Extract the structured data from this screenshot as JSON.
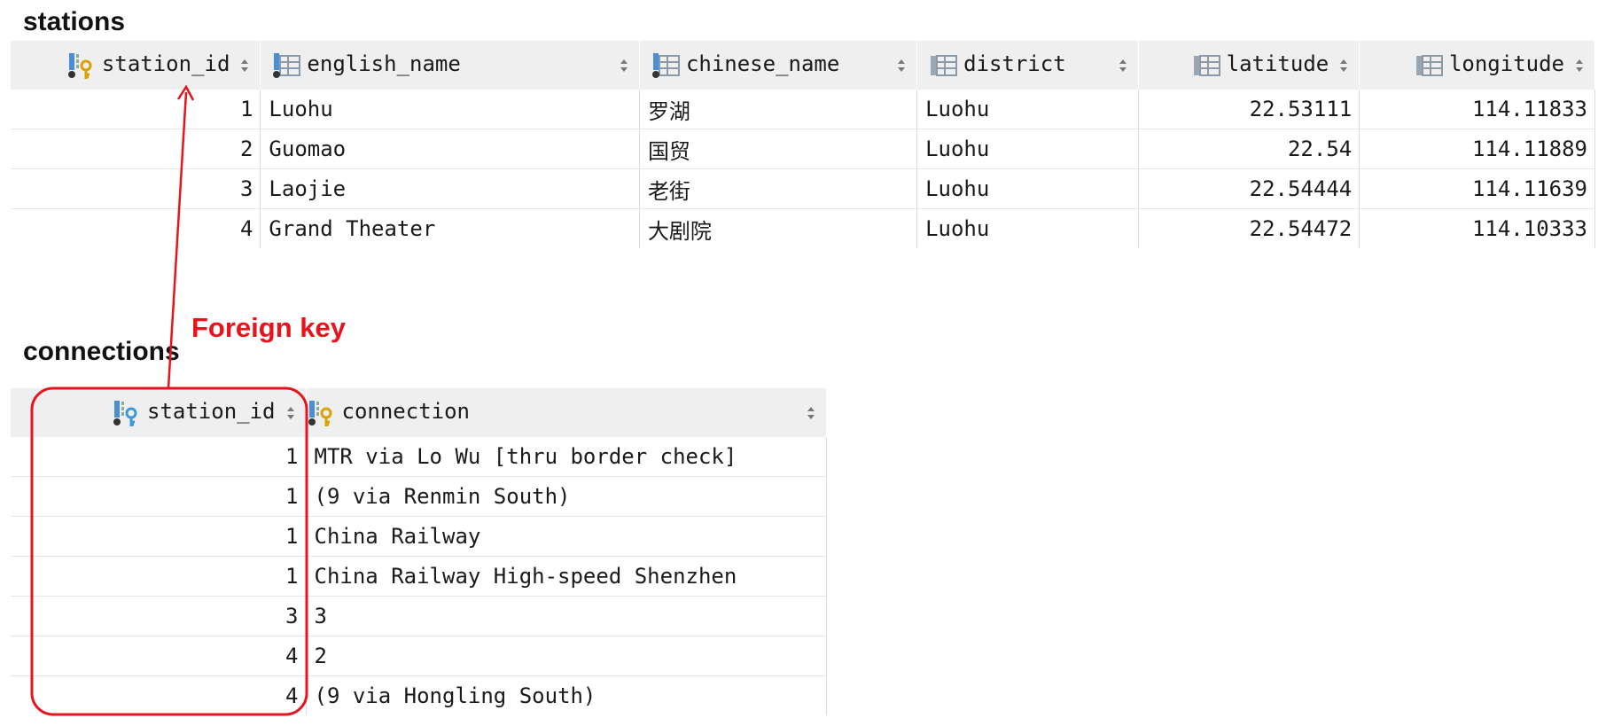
{
  "stations": {
    "title": "stations",
    "columns": [
      {
        "name": "station_id",
        "icon": "primary-key-column-icon"
      },
      {
        "name": "english_name",
        "icon": "column-icon"
      },
      {
        "name": "chinese_name",
        "icon": "column-icon"
      },
      {
        "name": "district",
        "icon": "column-icon"
      },
      {
        "name": "latitude",
        "icon": "column-icon"
      },
      {
        "name": "longitude",
        "icon": "column-icon"
      }
    ],
    "rows": [
      {
        "station_id": "1",
        "english_name": "Luohu",
        "chinese_name": "罗湖",
        "district": "Luohu",
        "latitude": "22.53111",
        "longitude": "114.11833"
      },
      {
        "station_id": "2",
        "english_name": "Guomao",
        "chinese_name": "国贸",
        "district": "Luohu",
        "latitude": "22.54",
        "longitude": "114.11889"
      },
      {
        "station_id": "3",
        "english_name": "Laojie",
        "chinese_name": "老街",
        "district": "Luohu",
        "latitude": "22.54444",
        "longitude": "114.11639"
      },
      {
        "station_id": "4",
        "english_name": "Grand Theater",
        "chinese_name": "大剧院",
        "district": "Luohu",
        "latitude": "22.54472",
        "longitude": "114.10333"
      }
    ]
  },
  "connections": {
    "title": "connections",
    "columns": [
      {
        "name": "station_id",
        "icon": "key-column-icon"
      },
      {
        "name": "connection",
        "icon": "key-column-icon"
      }
    ],
    "rows": [
      {
        "station_id": "1",
        "connection": "MTR via Lo Wu [thru border check]"
      },
      {
        "station_id": "1",
        "connection": "(9 via Renmin South)"
      },
      {
        "station_id": "1",
        "connection": "China Railway"
      },
      {
        "station_id": "1",
        "connection": "China Railway High-speed Shenzhen"
      },
      {
        "station_id": "3",
        "connection": "3"
      },
      {
        "station_id": "4",
        "connection": "2"
      },
      {
        "station_id": "4",
        "connection": "(9 via Hongling South)"
      }
    ]
  },
  "annotation": {
    "label": "Foreign key",
    "color": "#e8141c"
  }
}
